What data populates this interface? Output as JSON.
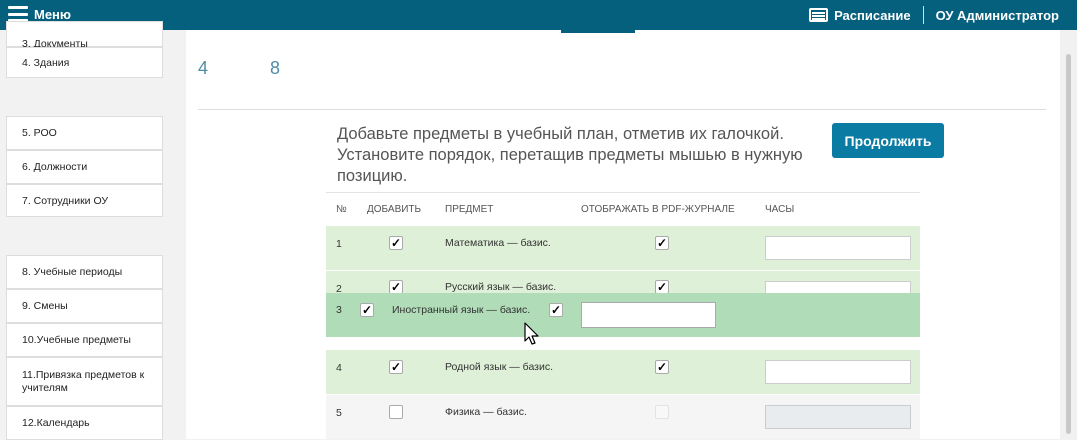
{
  "topbar": {
    "menu_label": "Меню",
    "schedule_label": "Расписание",
    "user_label": "ОУ Администратор",
    "menu_icon": "hamburger-icon",
    "schedule_icon": "schedule-list-icon"
  },
  "sidebar": {
    "items": [
      {
        "label": "3.  Документы"
      },
      {
        "label": "4.  Здания"
      },
      {
        "label": "5.  РОО"
      },
      {
        "label": "6.  Должности"
      },
      {
        "label": "7.  Сотрудники ОУ"
      },
      {
        "label": "8.  Учебные периоды"
      },
      {
        "label": "9.  Смены"
      },
      {
        "label": "10.Учебные предметы"
      },
      {
        "label": "11.Привязка предметов к учителям"
      },
      {
        "label": "12.Календарь"
      }
    ]
  },
  "steps": {
    "step_a": "4",
    "step_b": "8"
  },
  "main": {
    "description": "Добавьте предметы в учебный план, отметив их галочкой. Установите порядок, перетащив предметы мышью в нужную позицию.",
    "continue_label": "Продолжить"
  },
  "table": {
    "headers": {
      "num": "№",
      "add": "ДОБАВИТЬ",
      "subject": "ПРЕДМЕТ",
      "pdf": "ОТОБРАЖАТЬ В PDF-ЖУРНАЛЕ",
      "hours": "ЧАСЫ"
    },
    "rows": [
      {
        "num": "1",
        "subject": "Математика — базис.",
        "add": true,
        "pdf": true
      },
      {
        "num": "2",
        "subject": "Русский язык — базис.",
        "add": true,
        "pdf": true
      },
      {
        "num": "4",
        "subject": "Родной язык — базис.",
        "add": true,
        "pdf": true
      },
      {
        "num": "5",
        "subject": "Физика — базис.",
        "add": false,
        "pdf": false
      }
    ],
    "dragging": {
      "num": "3",
      "subject": "Иностранный язык — базис.",
      "add": true,
      "pdf": true
    }
  },
  "colors": {
    "topbar": "#05607e",
    "button": "#0a7ba3",
    "row_selected": "#dff0d8",
    "row_dragging": "#b0dcb8"
  }
}
